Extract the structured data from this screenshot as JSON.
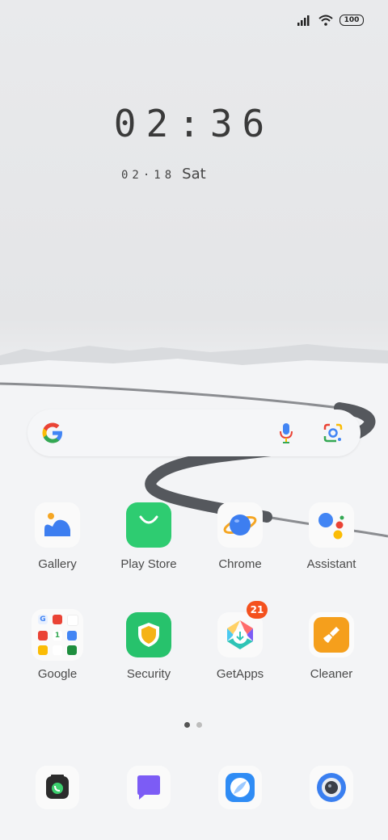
{
  "status_bar": {
    "signal_icon": "signal-bars-icon",
    "wifi_icon": "wifi-icon",
    "battery_level": "100"
  },
  "lockclock": {
    "time": "02:36",
    "date": "02·18",
    "weekday": "Sat"
  },
  "search_bar": {
    "google_icon": "google-g-icon",
    "mic_icon": "mic-icon",
    "lens_icon": "google-lens-icon"
  },
  "apps_row1": [
    {
      "label": "Gallery",
      "icon": "gallery-icon"
    },
    {
      "label": "Play Store",
      "icon": "play-store-icon"
    },
    {
      "label": "Chrome",
      "icon": "chrome-icon"
    },
    {
      "label": "Assistant",
      "icon": "assistant-icon"
    }
  ],
  "apps_row2": [
    {
      "label": "Google",
      "icon": "google-folder-icon"
    },
    {
      "label": "Security",
      "icon": "security-icon"
    },
    {
      "label": "GetApps",
      "icon": "getapps-icon",
      "badge": "21"
    },
    {
      "label": "Cleaner",
      "icon": "cleaner-icon"
    }
  ],
  "page_indicator": {
    "pages": 2,
    "current": 1
  },
  "dock": [
    {
      "icon": "phone-icon"
    },
    {
      "icon": "messages-icon"
    },
    {
      "icon": "browser-icon"
    },
    {
      "icon": "camera-icon"
    }
  ],
  "colors": {
    "badge": "#f4511e",
    "play_store_green": "#2ecc71",
    "security_green": "#27c26c",
    "cleaner_orange": "#f59f1c",
    "message_purple": "#7c5cf5"
  }
}
